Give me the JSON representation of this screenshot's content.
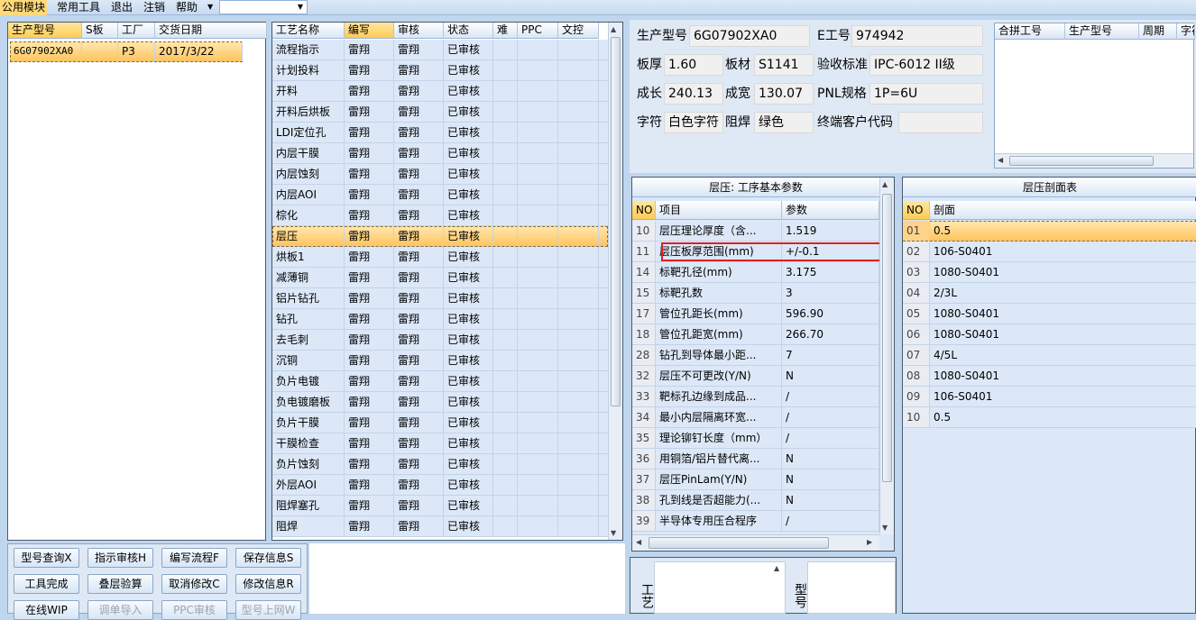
{
  "menu": [
    "公用模块",
    "常用工具",
    "退出",
    "注销",
    "帮助"
  ],
  "orders": {
    "headers": [
      "生产型号",
      "S板",
      "工厂",
      "交货日期"
    ],
    "rows": [
      [
        "6G07902XA0",
        "",
        "P3",
        "2017/3/22"
      ]
    ]
  },
  "process": {
    "headers": [
      "工艺名称",
      "编写",
      "审核",
      "状态",
      "难",
      "PPC",
      "文控"
    ],
    "rows": [
      [
        "流程指示",
        "雷翔",
        "雷翔",
        "已审核"
      ],
      [
        "计划投料",
        "雷翔",
        "雷翔",
        "已审核"
      ],
      [
        "开料",
        "雷翔",
        "雷翔",
        "已审核"
      ],
      [
        "开料后烘板",
        "雷翔",
        "雷翔",
        "已审核"
      ],
      [
        "LDI定位孔",
        "雷翔",
        "雷翔",
        "已审核"
      ],
      [
        "内层干膜",
        "雷翔",
        "雷翔",
        "已审核"
      ],
      [
        "内层蚀刻",
        "雷翔",
        "雷翔",
        "已审核"
      ],
      [
        "内层AOI",
        "雷翔",
        "雷翔",
        "已审核"
      ],
      [
        "棕化",
        "雷翔",
        "雷翔",
        "已审核"
      ],
      [
        "层压",
        "雷翔",
        "雷翔",
        "已审核"
      ],
      [
        "烘板1",
        "雷翔",
        "雷翔",
        "已审核"
      ],
      [
        "减薄铜",
        "雷翔",
        "雷翔",
        "已审核"
      ],
      [
        "铝片钻孔",
        "雷翔",
        "雷翔",
        "已审核"
      ],
      [
        "钻孔",
        "雷翔",
        "雷翔",
        "已审核"
      ],
      [
        "去毛刺",
        "雷翔",
        "雷翔",
        "已审核"
      ],
      [
        "沉铜",
        "雷翔",
        "雷翔",
        "已审核"
      ],
      [
        "负片电镀",
        "雷翔",
        "雷翔",
        "已审核"
      ],
      [
        "负电镀磨板",
        "雷翔",
        "雷翔",
        "已审核"
      ],
      [
        "负片干膜",
        "雷翔",
        "雷翔",
        "已审核"
      ],
      [
        "干膜检查",
        "雷翔",
        "雷翔",
        "已审核"
      ],
      [
        "负片蚀刻",
        "雷翔",
        "雷翔",
        "已审核"
      ],
      [
        "外层AOI",
        "雷翔",
        "雷翔",
        "已审核"
      ],
      [
        "阻焊塞孔",
        "雷翔",
        "雷翔",
        "已审核"
      ],
      [
        "阻焊",
        "雷翔",
        "雷翔",
        "已审核"
      ]
    ]
  },
  "info": {
    "model_label": "生产型号",
    "model": "6G07902XA0",
    "e_label": "E工号",
    "e": "974942",
    "thick_label": "板厚",
    "thick": "1.60",
    "mat_label": "板材",
    "mat": "S1141",
    "std_label": "验收标准",
    "std": "IPC-6012 II级",
    "len_label": "成长",
    "len": "240.13",
    "wid_label": "成宽",
    "wid": "130.07",
    "pnl_label": "PNL规格",
    "pnl": "1P=6U",
    "char_label": "字符",
    "char": "白色字符",
    "mask_label": "阻焊",
    "mask": "绿色",
    "cust_label": "终端客户代码",
    "cust": ""
  },
  "merge": {
    "headers": [
      "合拼工号",
      "生产型号",
      "周期",
      "字符"
    ]
  },
  "params": {
    "title": "层压: 工序基本参数",
    "headers": [
      "NO",
      "项目",
      "参数"
    ],
    "rows": [
      [
        "10",
        "层压理论厚度（含...",
        "1.519"
      ],
      [
        "11",
        "层压板厚范围(mm)",
        "+/-0.1"
      ],
      [
        "14",
        "标靶孔径(mm)",
        "3.175"
      ],
      [
        "15",
        "标靶孔数",
        "3"
      ],
      [
        "17",
        "管位孔距长(mm)",
        "596.90"
      ],
      [
        "18",
        "管位孔距宽(mm)",
        "266.70"
      ],
      [
        "28",
        "钻孔到导体最小距...",
        "7"
      ],
      [
        "32",
        "层压不可更改(Y/N)",
        "N"
      ],
      [
        "33",
        "靶标孔边缘到成品...",
        "/"
      ],
      [
        "34",
        "最小内层隔离环宽...",
        "/"
      ],
      [
        "35",
        "理论铆钉长度（mm）",
        "/"
      ],
      [
        "36",
        "用铜箔/铝片替代离...",
        "N"
      ],
      [
        "37",
        "层压PinLam(Y/N)",
        "N"
      ],
      [
        "38",
        "孔到线是否超能力(...",
        "N"
      ],
      [
        "39",
        "半导体专用压合程序",
        "/"
      ]
    ]
  },
  "stack": {
    "title": "层压剖面表",
    "headers": [
      "NO",
      "剖面"
    ],
    "rows": [
      [
        "01",
        "0.5"
      ],
      [
        "02",
        "106-S0401"
      ],
      [
        "03",
        "1080-S0401"
      ],
      [
        "04",
        "2/3L"
      ],
      [
        "05",
        "1080-S0401"
      ],
      [
        "06",
        "1080-S0401"
      ],
      [
        "07",
        "4/5L"
      ],
      [
        "08",
        "1080-S0401"
      ],
      [
        "09",
        "106-S0401"
      ],
      [
        "10",
        "0.5"
      ]
    ]
  },
  "buttons": [
    [
      "型号查询X",
      "指示审核H",
      "编写流程F",
      "保存信息S"
    ],
    [
      "工具完成",
      "叠层验算",
      "取消修改C",
      "修改信息R"
    ],
    [
      "在线WIP",
      "调单导入",
      "PPC审核",
      "型号上网W"
    ]
  ],
  "bottom": {
    "craft_label": "工艺",
    "model_label": "型号"
  }
}
